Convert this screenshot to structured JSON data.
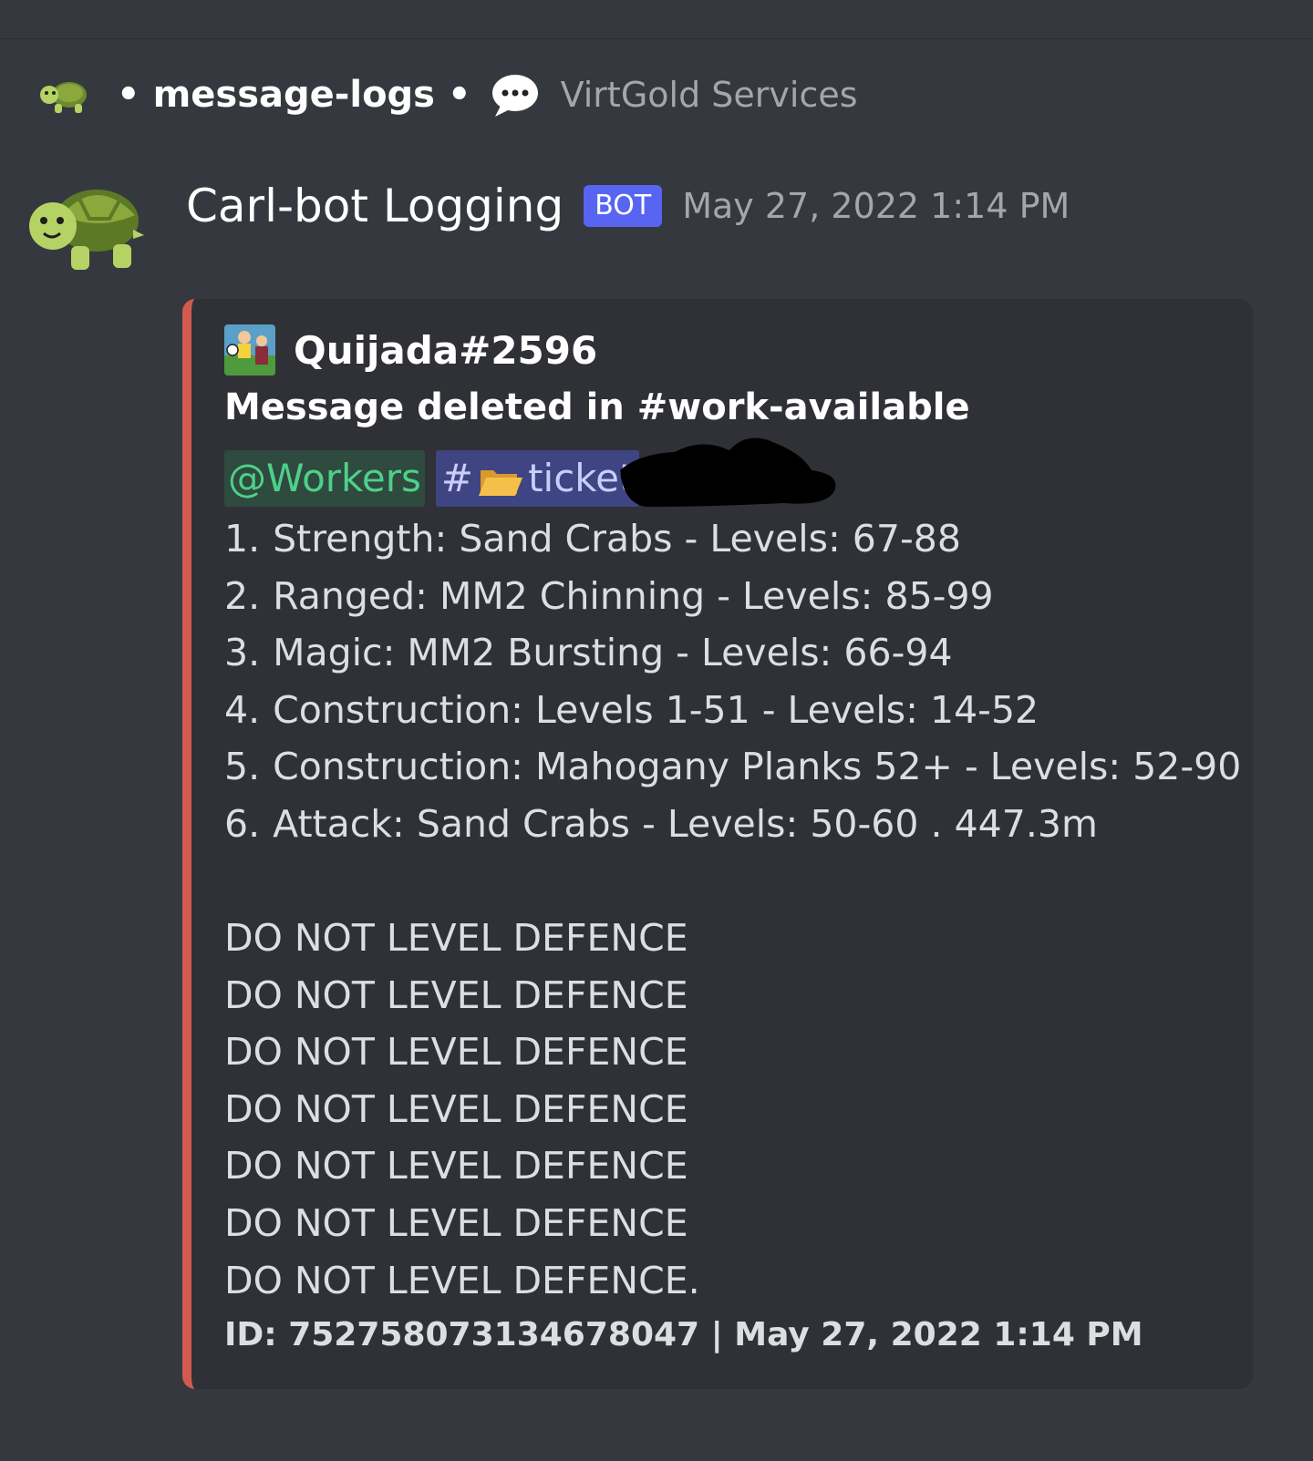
{
  "header": {
    "separator": "•",
    "channel_name": "message-logs",
    "server_name": "VirtGold Services",
    "turtle_icon": "turtle-icon",
    "thread_icon": "speech-bubble-icon"
  },
  "message": {
    "author": "Carl-bot Logging",
    "bot_tag": "BOT",
    "timestamp": "May 27, 2022 1:14 PM"
  },
  "embed": {
    "accent_color": "#d15b4e",
    "author_name": "Quijada#2596",
    "title": "Message deleted in #work-available",
    "role_mention": "@Workers",
    "channel_mention_prefix": "#",
    "channel_mention_text": "ticket",
    "list": [
      {
        "num": "1.",
        "text": "Strength: Sand Crabs - Levels: 67-88"
      },
      {
        "num": "2.",
        "text": "Ranged: MM2 Chinning - Levels: 85-99"
      },
      {
        "num": "3.",
        "text": "Magic: MM2 Bursting - Levels: 66-94"
      },
      {
        "num": "4.",
        "text": "Construction: Levels 1-51 - Levels: 14-52"
      },
      {
        "num": "5.",
        "text": "Construction: Mahogany Planks 52+ - Levels: 52-90"
      },
      {
        "num": "6.",
        "text": "Attack: Sand Crabs - Levels: 50-60 .   447.3m"
      }
    ],
    "warnings": [
      "DO NOT LEVEL DEFENCE",
      "DO NOT LEVEL DEFENCE",
      "DO NOT LEVEL DEFENCE",
      "DO NOT LEVEL DEFENCE",
      "DO NOT LEVEL DEFENCE",
      "DO NOT LEVEL DEFENCE",
      "DO NOT LEVEL DEFENCE."
    ],
    "footer": "ID: 752758073134678047 | May 27, 2022 1:14 PM"
  }
}
